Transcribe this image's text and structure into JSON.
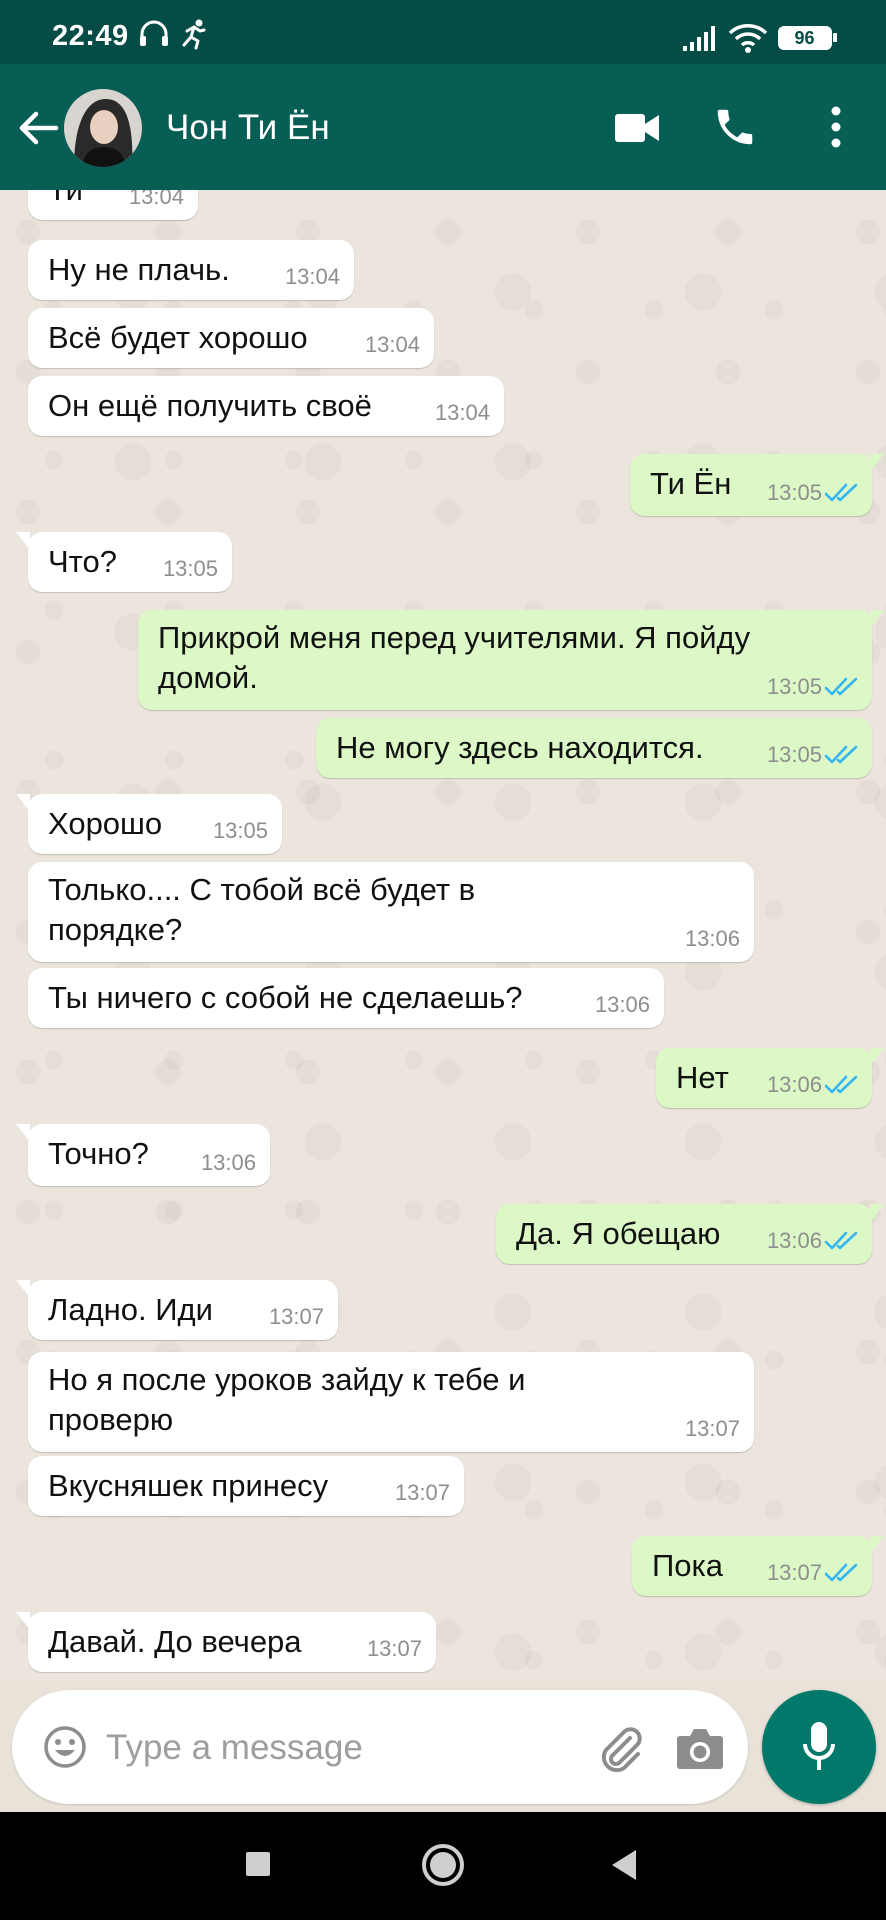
{
  "status_bar": {
    "time": "22:49",
    "battery": "96"
  },
  "header": {
    "contact_name": "Чон Ти Ён"
  },
  "colors": {
    "header": "#075e54",
    "status_bar": "#054c46",
    "incoming": "#ffffff",
    "outgoing": "#dcf8c6",
    "read_ticks": "#34b7f1",
    "mic_button": "#00796b"
  },
  "messages": [
    {
      "dir": "in",
      "text": "Ти",
      "time": "13:04"
    },
    {
      "dir": "in",
      "text": "Ну не плачь.",
      "time": "13:04"
    },
    {
      "dir": "in",
      "text": "Всё будет хорошо",
      "time": "13:04"
    },
    {
      "dir": "in",
      "text": "Он ещё получить своё",
      "time": "13:04"
    },
    {
      "dir": "out",
      "text": "Ти Ён",
      "time": "13:05",
      "status": "read"
    },
    {
      "dir": "in",
      "text": "Что?",
      "time": "13:05"
    },
    {
      "dir": "out",
      "text": "Прикрой меня перед учителями. Я пойду\nдомой.",
      "time": "13:05",
      "status": "read"
    },
    {
      "dir": "out",
      "text": "Не могу здесь находится.",
      "time": "13:05",
      "status": "read"
    },
    {
      "dir": "in",
      "text": "Хорошо",
      "time": "13:05"
    },
    {
      "dir": "in",
      "text": "Только.... С тобой всё будет в\nпорядке?",
      "time": "13:06"
    },
    {
      "dir": "in",
      "text": "Ты ничего с собой не сделаешь?",
      "time": "13:06"
    },
    {
      "dir": "out",
      "text": "Нет",
      "time": "13:06",
      "status": "read"
    },
    {
      "dir": "in",
      "text": "Точно?",
      "time": "13:06"
    },
    {
      "dir": "out",
      "text": "Да. Я обещаю",
      "time": "13:06",
      "status": "read"
    },
    {
      "dir": "in",
      "text": "Ладно. Иди",
      "time": "13:07"
    },
    {
      "dir": "in",
      "text": "Но я после уроков зайду к тебе и\nпроверю",
      "time": "13:07"
    },
    {
      "dir": "in",
      "text": "Вкусняшек принесу",
      "time": "13:07"
    },
    {
      "dir": "out",
      "text": "Пока",
      "time": "13:07",
      "status": "read"
    },
    {
      "dir": "in",
      "text": "Давай. До вечера",
      "time": "13:07"
    }
  ],
  "composer": {
    "placeholder": "Type a message"
  },
  "icons": {
    "back": "arrow-left-icon",
    "video": "video-camera-icon",
    "call": "phone-icon",
    "menu": "more-vertical-icon",
    "emoji": "emoji-icon",
    "attach": "paperclip-icon",
    "camera": "camera-icon",
    "mic": "microphone-icon",
    "nav_recent": "square-icon",
    "nav_home": "circle-icon",
    "nav_back": "triangle-back-icon"
  }
}
